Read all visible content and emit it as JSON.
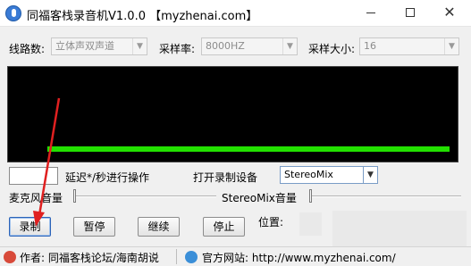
{
  "window": {
    "title": "同福客栈录音机V1.0.0 【myzhenai.com】",
    "min_icon": "minimize-icon",
    "max_icon": "maximize-icon",
    "close_glyph": "✕"
  },
  "settings": {
    "line_label": "线路数:",
    "line_value": "立体声双声道",
    "rate_label": "采样率:",
    "rate_value": "8000HZ",
    "size_label": "采样大小:",
    "size_value": "16"
  },
  "delay": {
    "value": "",
    "label": "延迟*/秒进行操作"
  },
  "device": {
    "label": "打开录制设备",
    "value": "StereoMix"
  },
  "volume": {
    "mic_label": "麦克风音量",
    "stereomix_label": "StereoMix音量"
  },
  "buttons": {
    "record": "录制",
    "pause": "暂停",
    "resume": "继续",
    "stop": "停止"
  },
  "position": {
    "label": "位置:"
  },
  "status": {
    "author": "作者: 同福客栈论坛/海南胡说",
    "website": "官方网站: http://www.myzhenai.com/"
  },
  "colors": {
    "level_meter": "#22e000",
    "scope_background": "#000000",
    "annotation_arrow": "#e02020"
  }
}
